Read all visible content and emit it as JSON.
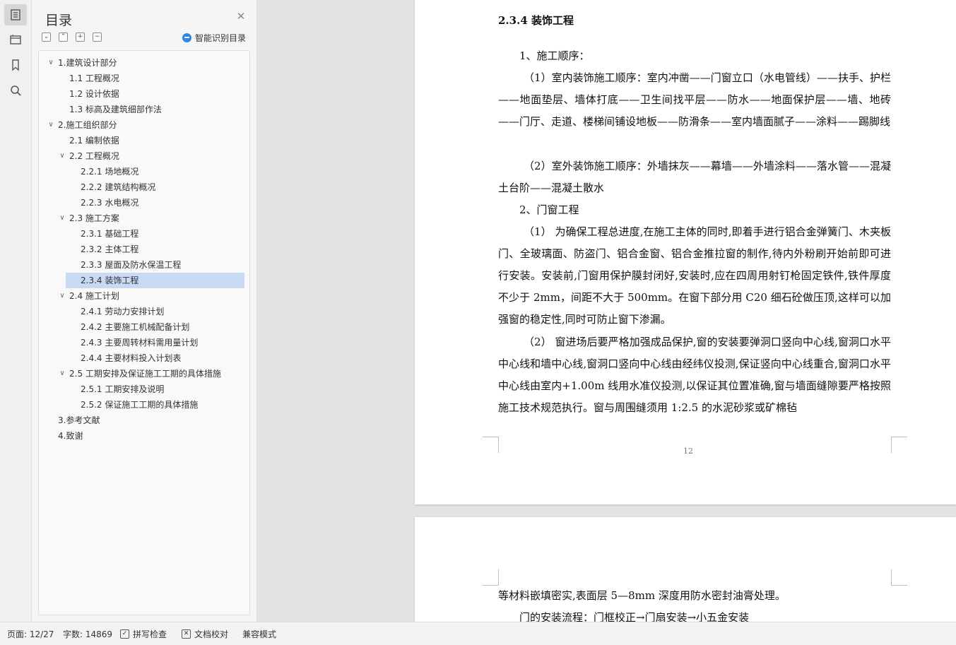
{
  "sidebar": {
    "title": "目录",
    "smart_toc_label": "智能识别目录",
    "items": [
      {
        "label": "1.建筑设计部分",
        "level": 1,
        "expanded": true
      },
      {
        "label": "1.1 工程概况",
        "level": 2
      },
      {
        "label": "1.2 设计依据",
        "level": 2
      },
      {
        "label": "1.3 标高及建筑细部作法",
        "level": 2
      },
      {
        "label": "2.施工组织部分",
        "level": 1,
        "expanded": true
      },
      {
        "label": "2.1 编制依据",
        "level": 2
      },
      {
        "label": "2.2 工程概况",
        "level": 2,
        "expanded": true
      },
      {
        "label": "2.2.1 场地概况",
        "level": 3
      },
      {
        "label": "2.2.2 建筑结构概况",
        "level": 3
      },
      {
        "label": "2.2.3 水电概况",
        "level": 3
      },
      {
        "label": "2.3 施工方案",
        "level": 2,
        "expanded": true
      },
      {
        "label": "2.3.1 基础工程",
        "level": 3
      },
      {
        "label": "2.3.2 主体工程",
        "level": 3
      },
      {
        "label": "2.3.3 屋面及防水保温工程",
        "level": 3
      },
      {
        "label": "2.3.4 装饰工程",
        "level": 3,
        "selected": true
      },
      {
        "label": "2.4 施工计划",
        "level": 2,
        "expanded": true
      },
      {
        "label": "2.4.1  劳动力安排计划",
        "level": 3
      },
      {
        "label": "2.4.2  主要施工机械配备计划",
        "level": 3
      },
      {
        "label": "2.4.3  主要周转材料需用量计划",
        "level": 3
      },
      {
        "label": "2.4.4  主要材料投入计划表",
        "level": 3
      },
      {
        "label": "2.5 工期安排及保证施工工期的具体措施",
        "level": 2,
        "expanded": true
      },
      {
        "label": "2.5.1 工期安排及说明",
        "level": 3
      },
      {
        "label": "2.5.2  保证施工工期的具体措施",
        "level": 3
      },
      {
        "label": "3.参考文献",
        "level": 1
      },
      {
        "label": "4.致谢",
        "level": 1
      }
    ]
  },
  "document": {
    "section_title": "2.3.4 装饰工程",
    "paragraphs": [
      "1、施工顺序：",
      "（1）室内装饰施工顺序：室内冲凿——门窗立口（水电管线）——扶手、护栏——地面垫层、墙体打底——卫生间找平层——防水——地面保护层——墙、地砖——门厅、走道、楼梯间铺设地板——防滑条——室内墙面腻子——涂料——踢脚线",
      "（2）室外装饰施工顺序：外墙抹灰——幕墙——外墙涂料——落水管——混凝土台阶——混凝土散水",
      "2、门窗工程",
      "（1） 为确保工程总进度,在施工主体的同时,即着手进行铝合金弹簧门、木夹板门、全玻璃面、防盗门、铝合金窗、铝合金推拉窗的制作,待内外粉刷开始前即可进行安装。安装前,门窗用保护膜封闭好,安装时,应在四周用射钉枪固定铁件,铁件厚度不少于 2mm，间距不大于 500mm。在窗下部分用 C20 细石砼做压顶,这样可以加强窗的稳定性,同时可防止窗下渗漏。",
      "（2） 窗进场后要严格加强成品保护,窗的安装要弹洞口竖向中心线,窗洞口水平中心线和墙中心线,窗洞口竖向中心线由经纬仪投测,保证竖向中心线重合,窗洞口水平中心线由室内+1.00m 线用水准仪投测,以保证其位置准确,窗与墙面缝隙要严格按照施工技术规范执行。窗与周围缝须用 1:2.5 的水泥砂浆或矿棉毡"
    ],
    "page_number": "12",
    "page2_paragraphs": [
      "等材料嵌填密实,表面层 5—8mm 深度用防水密封油膏处理。",
      "门的安装流程：门框校正→门扇安装→小五金安装"
    ]
  },
  "status_bar": {
    "page": "页面: 12/27",
    "words": "字数: 14869",
    "spell_check": "拼写检查",
    "doc_check": "文档校对",
    "compat_mode": "兼容模式"
  }
}
